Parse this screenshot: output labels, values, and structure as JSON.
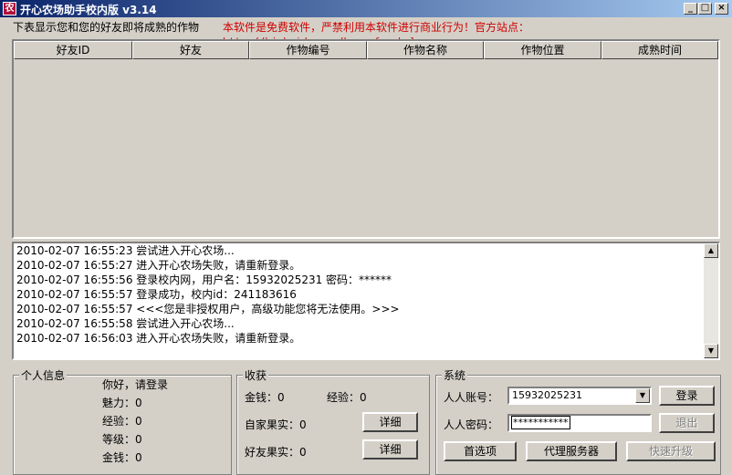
{
  "window": {
    "title": "开心农场助手校内版 v3.14",
    "app_icon": "农",
    "controls": {
      "minimize": "_",
      "maximize": "□",
      "close": "×"
    }
  },
  "header": {
    "subtitle": "下表显示您和您的好友即将成熟的作物",
    "notice": "本软件是免费软件，严禁利用本软件进行商业行为！官方站点：",
    "url": "http://hi.baidu.com/happyfarmhelper",
    "notice_color": "#d00000"
  },
  "table": {
    "columns": [
      "好友ID",
      "好友",
      "作物编号",
      "作物名称",
      "作物位置",
      "成熟时间"
    ],
    "rows": []
  },
  "log": {
    "lines": [
      "2010-02-07 16:55:23 尝试进入开心农场...",
      "2010-02-07 16:55:27 进入开心农场失败，请重新登录。",
      "2010-02-07 16:55:56 登录校内网，用户名：15932025231 密码：******",
      "2010-02-07 16:55:57 登录成功，校内id：241183616",
      "2010-02-07 16:55:57 <<<您是非授权用户，高级功能您将无法使用。>>>",
      "2010-02-07 16:55:58 尝试进入开心农场...",
      "2010-02-07 16:56:03 进入开心农场失败，请重新登录。"
    ],
    "scroll_up_icon": "▲",
    "scroll_down_icon": "▼"
  },
  "personal": {
    "title": "个人信息",
    "greeting": "你好，请登录",
    "charm": "魅力：0",
    "exp": "经验：0",
    "level": "等级：0",
    "money": "金钱：0"
  },
  "harvest": {
    "title": "收获",
    "money": "金钱：0",
    "exp": "经验：0",
    "own_fruit": "自家果实：0",
    "friend_fruit": "好友果实：0",
    "detail_label": "详细"
  },
  "system": {
    "title": "系统",
    "account_label": "人人账号：",
    "account_value": "15932025231",
    "dropdown_icon": "▼",
    "password_label": "人人密码：",
    "password_value": "***********",
    "login_label": "登录",
    "logout_label": "退出",
    "options_label": "首选项",
    "proxy_label": "代理服务器",
    "upgrade_label": "快速升级"
  }
}
